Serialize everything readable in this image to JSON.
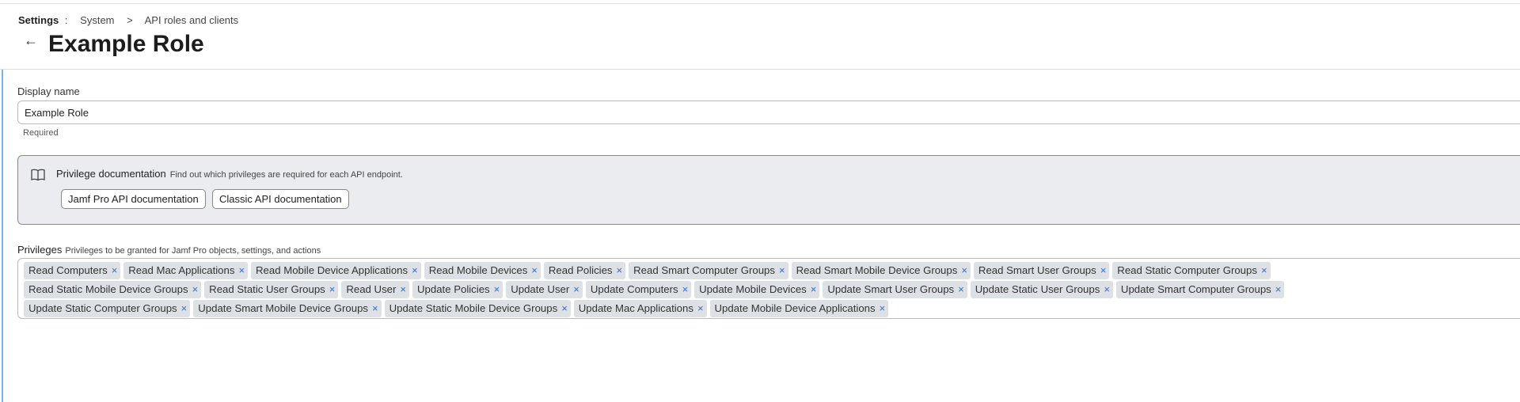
{
  "breadcrumb": {
    "root": "Settings",
    "separator": ":",
    "items": [
      "System",
      "API roles and clients"
    ],
    "chevron": ">"
  },
  "header": {
    "back_icon": "←",
    "title": "Example Role"
  },
  "display_name": {
    "label": "Display name",
    "value": "Example Role",
    "helper": "Required"
  },
  "privilege_docs": {
    "icon": "book-icon",
    "title": "Privilege documentation",
    "description": "Find out which privileges are required for each API endpoint.",
    "buttons": [
      "Jamf Pro API documentation",
      "Classic API documentation"
    ]
  },
  "privileges": {
    "label": "Privileges",
    "description": "Privileges to be granted for Jamf Pro objects, settings, and actions",
    "remove_glyph": "×",
    "tags": [
      "Read Computers",
      "Read Mac Applications",
      "Read Mobile Device Applications",
      "Read Mobile Devices",
      "Read Policies",
      "Read Smart Computer Groups",
      "Read Smart Mobile Device Groups",
      "Read Smart User Groups",
      "Read Static Computer Groups",
      "Read Static Mobile Device Groups",
      "Read Static User Groups",
      "Read User",
      "Update Policies",
      "Update User",
      "Update Computers",
      "Update Mobile Devices",
      "Update Smart User Groups",
      "Update Static User Groups",
      "Update Smart Computer Groups",
      "Update Static Computer Groups",
      "Update Smart Mobile Device Groups",
      "Update Static Mobile Device Groups",
      "Update Mac Applications",
      "Update Mobile Device Applications"
    ]
  },
  "colors": {
    "accent": "#2d6fd6",
    "tag_bg": "#dde0e4",
    "doc_bg": "#eaecef",
    "left_bar": "#7ab3e6"
  }
}
